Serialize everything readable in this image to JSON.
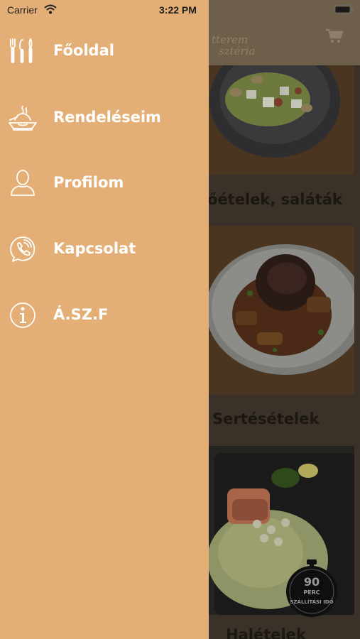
{
  "status_bar": {
    "carrier": "Carrier",
    "time": "3:22 PM"
  },
  "header": {
    "logo_text_line1": "tterem",
    "logo_text_line2": "sztéria"
  },
  "categories": [
    {
      "title": "őételek, saláták"
    },
    {
      "title": "Sertésételek"
    },
    {
      "title": "Halételek"
    }
  ],
  "badge": {
    "number": "90",
    "unit": "PERC",
    "caption": "SZÁLLÍTÁSI IDŐ"
  },
  "menu": {
    "items": [
      {
        "label": "Főoldal",
        "icon": "utensils-icon"
      },
      {
        "label": "Rendeléseim",
        "icon": "food-tray-icon"
      },
      {
        "label": "Profilom",
        "icon": "user-icon"
      },
      {
        "label": "Kapcsolat",
        "icon": "phone-icon"
      },
      {
        "label": "Á.SZ.F",
        "icon": "info-icon"
      }
    ]
  }
}
